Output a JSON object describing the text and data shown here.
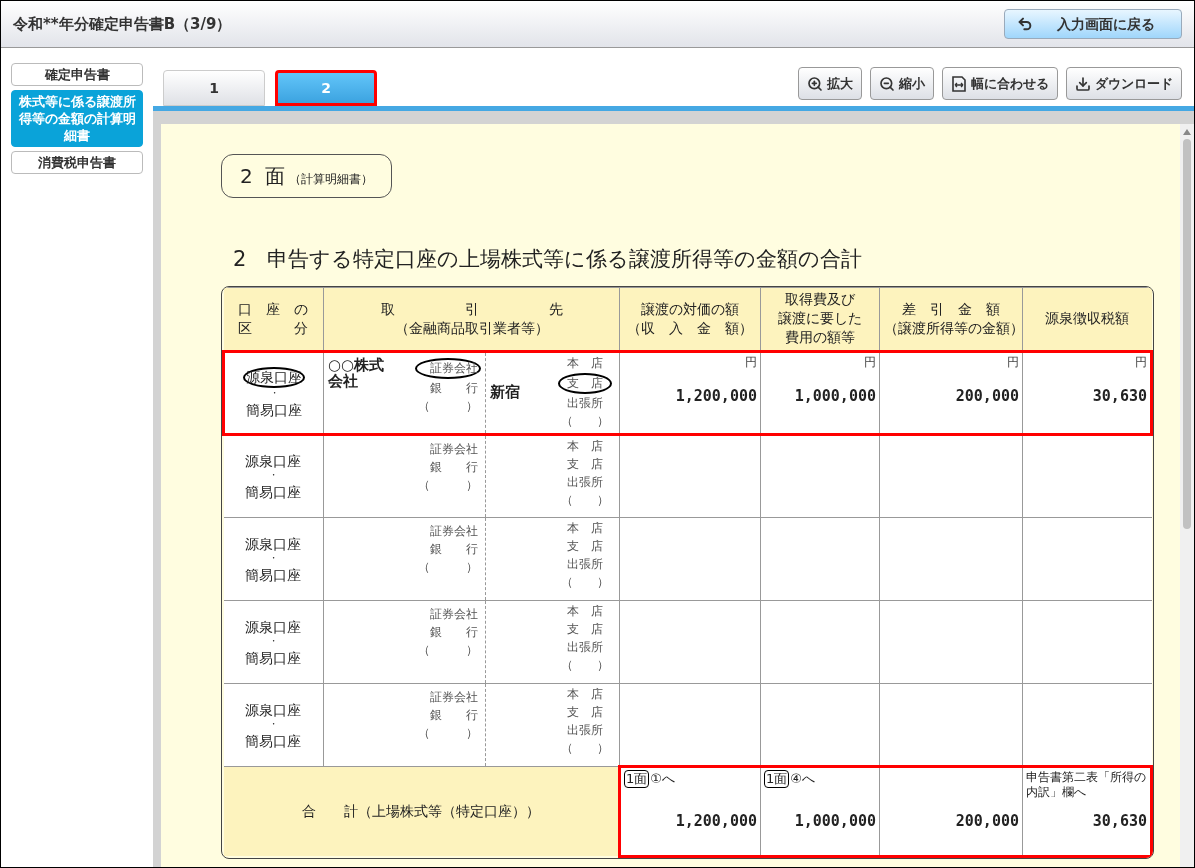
{
  "window": {
    "title": "令和**年分確定申告書B（3/9）"
  },
  "back_button": {
    "label": "入力画面に戻る"
  },
  "sidebar": {
    "items": [
      {
        "label": "確定申告書",
        "selected": false
      },
      {
        "label": "株式等に係る譲渡所得等の金額の計算明細書",
        "selected": true
      },
      {
        "label": "消費税申告書",
        "selected": false
      }
    ]
  },
  "tabs": [
    {
      "label": "1",
      "selected": false,
      "highlighted": false
    },
    {
      "label": "2",
      "selected": true,
      "highlighted": true
    }
  ],
  "toolbar": [
    {
      "label": "拡大",
      "kind": "zoom-in"
    },
    {
      "label": "縮小",
      "kind": "zoom-out"
    },
    {
      "label": "幅に合わせる",
      "kind": "fit"
    },
    {
      "label": "ダウンロード",
      "kind": "download"
    }
  ],
  "document": {
    "badge": {
      "number": "2",
      "face": "面",
      "note": "（計算明細書）"
    },
    "heading": "2　申告する特定口座の上場株式等に係る譲渡所得等の金額の合計",
    "columns": [
      {
        "lines": [
          "口　座　の",
          "区　　　分"
        ]
      },
      {
        "lines": [
          "取　　　　　引　　　　　先",
          "（金融商品取引業者等）"
        ]
      },
      {
        "lines": [
          "譲渡の対価の額",
          "（収　入　金　額）"
        ]
      },
      {
        "lines": [
          "取得費及び",
          "譲渡に要した",
          "費用の額等"
        ]
      },
      {
        "lines": [
          "差　引　金　額",
          "（譲渡所得等の金額）"
        ]
      },
      {
        "lines": [
          "源泉徴収税額"
        ]
      }
    ],
    "rows": [
      {
        "highlighted": true,
        "account": [
          {
            "label": "源泉口座",
            "selected": true
          },
          {
            "label": "簡易口座",
            "selected": false
          }
        ],
        "separator": "・",
        "broker": "○○株式会社",
        "broker_types": [
          {
            "label": "証券会社",
            "selected": true
          },
          {
            "label": "銀　　行",
            "selected": false
          },
          {
            "label": "（　　　）",
            "selected": false
          }
        ],
        "branch": "新宿",
        "branch_types": [
          {
            "label": "本　店",
            "selected": false
          },
          {
            "label": "支　店",
            "selected": true
          },
          {
            "label": "出張所",
            "selected": false
          },
          {
            "label": "（　　）",
            "selected": false
          }
        ],
        "amounts": [
          {
            "unit": "円",
            "value": "1,200,000"
          },
          {
            "unit": "円",
            "value": "1,000,000"
          },
          {
            "unit": "円",
            "value": "200,000"
          },
          {
            "unit": "円",
            "value": "30,630"
          }
        ]
      },
      {
        "highlighted": false,
        "account": [
          {
            "label": "源泉口座",
            "selected": false
          },
          {
            "label": "簡易口座",
            "selected": false
          }
        ],
        "separator": "・",
        "broker_types": [
          {
            "label": "証券会社",
            "selected": false
          },
          {
            "label": "銀　　行",
            "selected": false
          },
          {
            "label": "（　　　）",
            "selected": false
          }
        ],
        "branch_types": [
          {
            "label": "本　店",
            "selected": false
          },
          {
            "label": "支　店",
            "selected": false
          },
          {
            "label": "出張所",
            "selected": false
          },
          {
            "label": "（　　）",
            "selected": false
          }
        ]
      },
      {
        "highlighted": false,
        "account": [
          {
            "label": "源泉口座",
            "selected": false
          },
          {
            "label": "簡易口座",
            "selected": false
          }
        ],
        "separator": "・",
        "broker_types": [
          {
            "label": "証券会社",
            "selected": false
          },
          {
            "label": "銀　　行",
            "selected": false
          },
          {
            "label": "（　　　）",
            "selected": false
          }
        ],
        "branch_types": [
          {
            "label": "本　店",
            "selected": false
          },
          {
            "label": "支　店",
            "selected": false
          },
          {
            "label": "出張所",
            "selected": false
          },
          {
            "label": "（　　）",
            "selected": false
          }
        ]
      },
      {
        "highlighted": false,
        "account": [
          {
            "label": "源泉口座",
            "selected": false
          },
          {
            "label": "簡易口座",
            "selected": false
          }
        ],
        "separator": "・",
        "broker_types": [
          {
            "label": "証券会社",
            "selected": false
          },
          {
            "label": "銀　　行",
            "selected": false
          },
          {
            "label": "（　　　）",
            "selected": false
          }
        ],
        "branch_types": [
          {
            "label": "本　店",
            "selected": false
          },
          {
            "label": "支　店",
            "selected": false
          },
          {
            "label": "出張所",
            "selected": false
          },
          {
            "label": "（　　）",
            "selected": false
          }
        ]
      },
      {
        "highlighted": false,
        "account": [
          {
            "label": "源泉口座",
            "selected": false
          },
          {
            "label": "簡易口座",
            "selected": false
          }
        ],
        "separator": "・",
        "broker_types": [
          {
            "label": "証券会社",
            "selected": false
          },
          {
            "label": "銀　　行",
            "selected": false
          },
          {
            "label": "（　　　）",
            "selected": false
          }
        ],
        "branch_types": [
          {
            "label": "本　店",
            "selected": false
          },
          {
            "label": "支　店",
            "selected": false
          },
          {
            "label": "出張所",
            "selected": false
          },
          {
            "label": "（　　）",
            "selected": false
          }
        ]
      }
    ],
    "total": {
      "label": "合　　計（上場株式等（特定口座））",
      "highlighted": true,
      "cells": [
        {
          "ref_box": "1面",
          "ref": "①へ",
          "value": "1,200,000"
        },
        {
          "ref_box": "1面",
          "ref": "④へ",
          "value": "1,000,000"
        },
        {
          "value": "200,000"
        },
        {
          "note": "申告書第二表「所得の内訳」欄へ",
          "value": "30,630"
        }
      ]
    }
  }
}
